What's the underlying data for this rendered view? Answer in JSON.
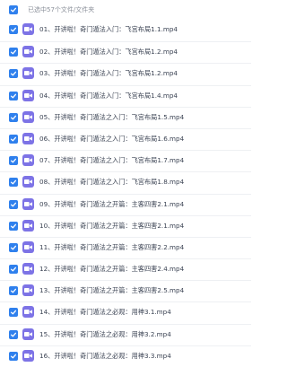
{
  "header": {
    "selected_text": "已选中57个文件/文件夹"
  },
  "files": [
    {
      "name": "01、开讲啦！奇门遁法入门：飞宫布局1.1.mp4"
    },
    {
      "name": "02、开讲啦！奇门遁法入门：飞宫布局1.2.mp4"
    },
    {
      "name": "03、开讲啦！奇门遁法入门：飞宫布局1.2.mp4"
    },
    {
      "name": "04、开讲啦！奇门遁法入门：飞宫布局1.4.mp4"
    },
    {
      "name": "05、开讲啦！奇门遁法之入门：飞宫布局1.5.mp4"
    },
    {
      "name": "06、开讲啦！奇门遁法之入门：飞宫布局1.6.mp4"
    },
    {
      "name": "07、开讲啦！奇门遁法之入门：飞宫布局1.7.mp4"
    },
    {
      "name": "08、开讲啦！奇门遁法之入门：飞宫布局1.8.mp4"
    },
    {
      "name": "09、开讲啦！奇门遁法之开篇：主客四害2.1.mp4"
    },
    {
      "name": "10、开讲啦！奇门遁法之开篇：主客四害2.1.mp4"
    },
    {
      "name": "11、开讲啦！奇门遁法之开篇：主客四害2.2.mp4"
    },
    {
      "name": "12、开讲啦！奇门遁法之开篇：主客四害2.4.mp4"
    },
    {
      "name": "13、开讲啦！奇门遁法之开篇：主客四害2.5.mp4"
    },
    {
      "name": "14、开讲啦！奇门遁法之必观：用神3.1.mp4"
    },
    {
      "name": "15、开讲啦！奇门遁法之必观：用神3.2.mp4"
    },
    {
      "name": "16、开讲啦！奇门遁法之必观：用神3.3.mp4"
    }
  ]
}
